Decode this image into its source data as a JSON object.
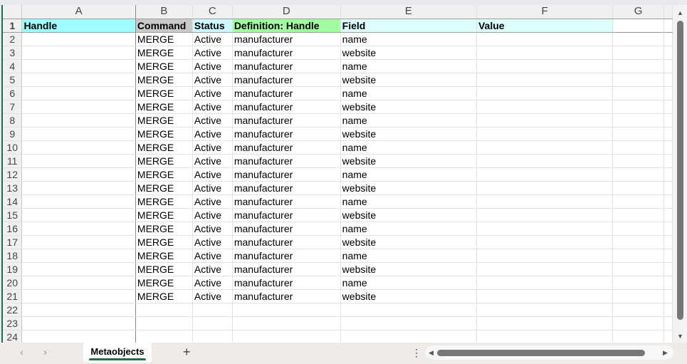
{
  "columns": [
    "A",
    "B",
    "C",
    "D",
    "E",
    "F",
    "G"
  ],
  "header_row": [
    "Handle",
    "Command",
    "Status",
    "Definition: Handle",
    "Field",
    "Value",
    ""
  ],
  "header_colors": [
    "#9ffcfc",
    "#c9c9c9",
    "#ccf7ff",
    "#a1fba1",
    "#ddfdfd",
    "#ddfdfd",
    "#ffffff"
  ],
  "rows": [
    [
      "",
      "MERGE",
      "Active",
      "manufacturer",
      "name",
      "",
      ""
    ],
    [
      "",
      "MERGE",
      "Active",
      "manufacturer",
      "website",
      "",
      ""
    ],
    [
      "",
      "MERGE",
      "Active",
      "manufacturer",
      "name",
      "",
      ""
    ],
    [
      "",
      "MERGE",
      "Active",
      "manufacturer",
      "website",
      "",
      ""
    ],
    [
      "",
      "MERGE",
      "Active",
      "manufacturer",
      "name",
      "",
      ""
    ],
    [
      "",
      "MERGE",
      "Active",
      "manufacturer",
      "website",
      "",
      ""
    ],
    [
      "",
      "MERGE",
      "Active",
      "manufacturer",
      "name",
      "",
      ""
    ],
    [
      "",
      "MERGE",
      "Active",
      "manufacturer",
      "website",
      "",
      ""
    ],
    [
      "",
      "MERGE",
      "Active",
      "manufacturer",
      "name",
      "",
      ""
    ],
    [
      "",
      "MERGE",
      "Active",
      "manufacturer",
      "website",
      "",
      ""
    ],
    [
      "",
      "MERGE",
      "Active",
      "manufacturer",
      "name",
      "",
      ""
    ],
    [
      "",
      "MERGE",
      "Active",
      "manufacturer",
      "website",
      "",
      ""
    ],
    [
      "",
      "MERGE",
      "Active",
      "manufacturer",
      "name",
      "",
      ""
    ],
    [
      "",
      "MERGE",
      "Active",
      "manufacturer",
      "website",
      "",
      ""
    ],
    [
      "",
      "MERGE",
      "Active",
      "manufacturer",
      "name",
      "",
      ""
    ],
    [
      "",
      "MERGE",
      "Active",
      "manufacturer",
      "website",
      "",
      ""
    ],
    [
      "",
      "MERGE",
      "Active",
      "manufacturer",
      "name",
      "",
      ""
    ],
    [
      "",
      "MERGE",
      "Active",
      "manufacturer",
      "website",
      "",
      ""
    ],
    [
      "",
      "MERGE",
      "Active",
      "manufacturer",
      "name",
      "",
      ""
    ],
    [
      "",
      "MERGE",
      "Active",
      "manufacturer",
      "website",
      "",
      ""
    ],
    [
      "",
      "",
      "",
      "",
      "",
      "",
      ""
    ],
    [
      "",
      "",
      "",
      "",
      "",
      "",
      ""
    ],
    [
      "",
      "",
      "",
      "",
      "",
      "",
      ""
    ]
  ],
  "sheet_tab": "Metaobjects",
  "add_sheet": "+",
  "nav_prev": "‹",
  "nav_next": "›",
  "more": "⋮"
}
